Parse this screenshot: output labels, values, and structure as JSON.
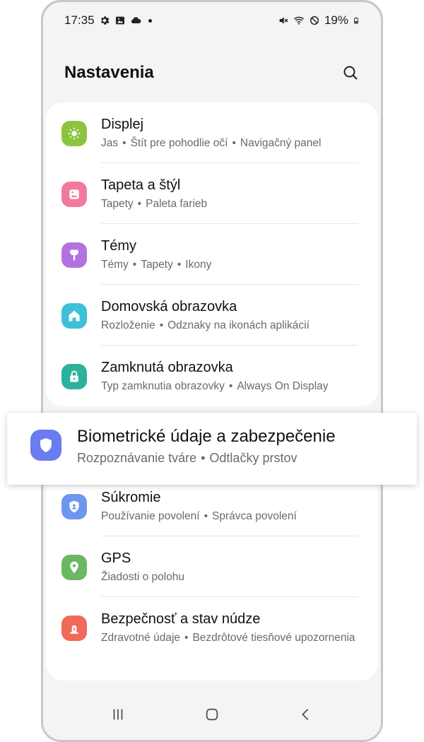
{
  "status_bar": {
    "time": "17:35",
    "battery": "19%",
    "left_icons": [
      "gear-icon",
      "image-icon",
      "cloud-icon",
      "dot-icon"
    ],
    "right_icons": [
      "mute-icon",
      "wifi-icon",
      "blocked-icon",
      "battery-icon"
    ]
  },
  "header": {
    "title": "Nastavenia",
    "search_icon": "search-icon"
  },
  "items_top": [
    {
      "title": "Displej",
      "subtitle": [
        "Jas",
        "Štít pre pohodlie očí",
        "Navigačný panel"
      ],
      "icon": "sun-icon",
      "color": "#8bc53f"
    },
    {
      "title": "Tapeta a štýl",
      "subtitle": [
        "Tapety",
        "Paleta farieb"
      ],
      "icon": "wallpaper-icon",
      "color": "#f07a9b"
    },
    {
      "title": "Témy",
      "subtitle": [
        "Témy",
        "Tapety",
        "Ikony"
      ],
      "icon": "brush-icon",
      "color": "#b073e0"
    },
    {
      "title": "Domovská obrazovka",
      "subtitle": [
        "Rozloženie",
        "Odznaky na ikonách aplikácií"
      ],
      "icon": "home-icon",
      "color": "#3ec0d8"
    },
    {
      "title": "Zamknutá obrazovka",
      "subtitle": [
        "Typ zamknutia obrazovky",
        "Always On Display"
      ],
      "icon": "lock-icon",
      "color": "#2ab39a"
    }
  ],
  "highlighted": {
    "title": "Biometrické údaje a zabezpečenie",
    "subtitle": [
      "Rozpoznávanie tváre",
      "Odtlačky prstov"
    ],
    "icon": "shield-icon",
    "color": "#6b7bf0"
  },
  "items_bottom": [
    {
      "title": "Súkromie",
      "subtitle": [
        "Používanie povolení",
        "Správca povolení"
      ],
      "icon": "privacy-shield-icon",
      "color": "#6e95f0"
    },
    {
      "title": "GPS",
      "subtitle": [
        "Žiadosti o polohu"
      ],
      "icon": "location-pin-icon",
      "color": "#6ab862"
    },
    {
      "title": "Bezpečnosť a stav núdze",
      "subtitle": [
        "Zdravotné údaje",
        "Bezdrôtové tiesňové upozornenia"
      ],
      "icon": "emergency-icon",
      "color": "#f06a5a"
    }
  ],
  "separator": "•",
  "nav": [
    "recents-icon",
    "home-button-icon",
    "back-icon"
  ]
}
